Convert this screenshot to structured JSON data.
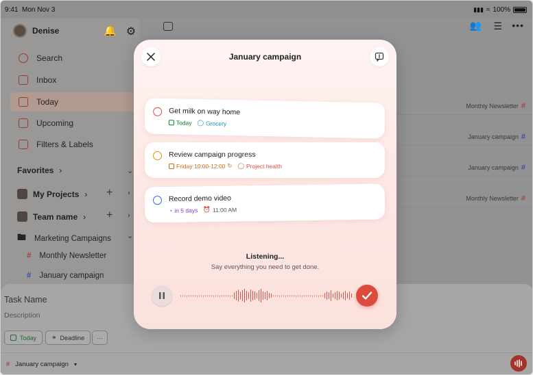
{
  "status_bar": {
    "time": "9:41",
    "date": "Mon Nov 3",
    "battery": "100%"
  },
  "sidebar": {
    "user_name": "Denise",
    "nav": [
      {
        "label": "Search",
        "icon": "search-icon"
      },
      {
        "label": "Inbox",
        "icon": "inbox-icon"
      },
      {
        "label": "Today",
        "icon": "calendar-today-icon"
      },
      {
        "label": "Upcoming",
        "icon": "calendar-icon"
      },
      {
        "label": "Filters & Labels",
        "icon": "grid-icon"
      }
    ],
    "favorites_label": "Favorites",
    "my_projects_label": "My Projects",
    "team_label": "Team name",
    "folder_label": "Marketing Campaigns",
    "projects": [
      "Monthly Newsletter",
      "January campaign"
    ]
  },
  "main": {
    "rows": [
      "Monthly Newsletter",
      "January campaign",
      "January campaign",
      "Monthly Newsletter"
    ]
  },
  "quick_add": {
    "title_placeholder": "Task Name",
    "description_placeholder": "Description",
    "chip_today": "Today",
    "chip_deadline": "Deadline",
    "chip_more": "···",
    "project": "January campaign"
  },
  "modal": {
    "title": "January campaign",
    "tasks": [
      {
        "title": "Get milk on way home",
        "date": "Today",
        "label": "Grocery",
        "check_color": "#dc4c3e"
      },
      {
        "title": "Review campaign progress",
        "date": "Friday 10:00-12:00",
        "label": "Project health",
        "check_color": "#eb8909"
      },
      {
        "title": "Record demo video",
        "date": "in 5 days",
        "reminder": "11:00 AM",
        "check_color": "#246fe0"
      }
    ],
    "listening_title": "Listening...",
    "listening_subtitle": "Say everything you need to get done."
  },
  "colors": {
    "accent": "#dc4c3e",
    "today_green": "#058527",
    "label_blue": "#1c8ec4",
    "orange": "#d2690f",
    "purple": "#7c3fcf"
  }
}
